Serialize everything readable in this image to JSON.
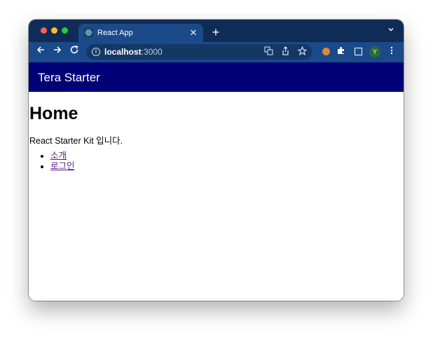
{
  "browser": {
    "tab": {
      "title": "React App",
      "favicon": "react-logo-icon",
      "close": "✕"
    },
    "new_tab": "+",
    "tab_menu": "⌄",
    "address": {
      "host": "localhost",
      "port": ":3000"
    },
    "avatar_initial": "Y",
    "colors": {
      "tabstrip": "#0f2c57",
      "toolbar": "#1a4a8a",
      "omnibox": "#143866"
    }
  },
  "page": {
    "brand": "Tera Starter",
    "title": "Home",
    "description": "React Starter Kit 입니다.",
    "nav_links": [
      {
        "label": "소개"
      },
      {
        "label": "로그인"
      }
    ],
    "colors": {
      "header_bg": "#000077",
      "link": "#551a8b"
    }
  }
}
